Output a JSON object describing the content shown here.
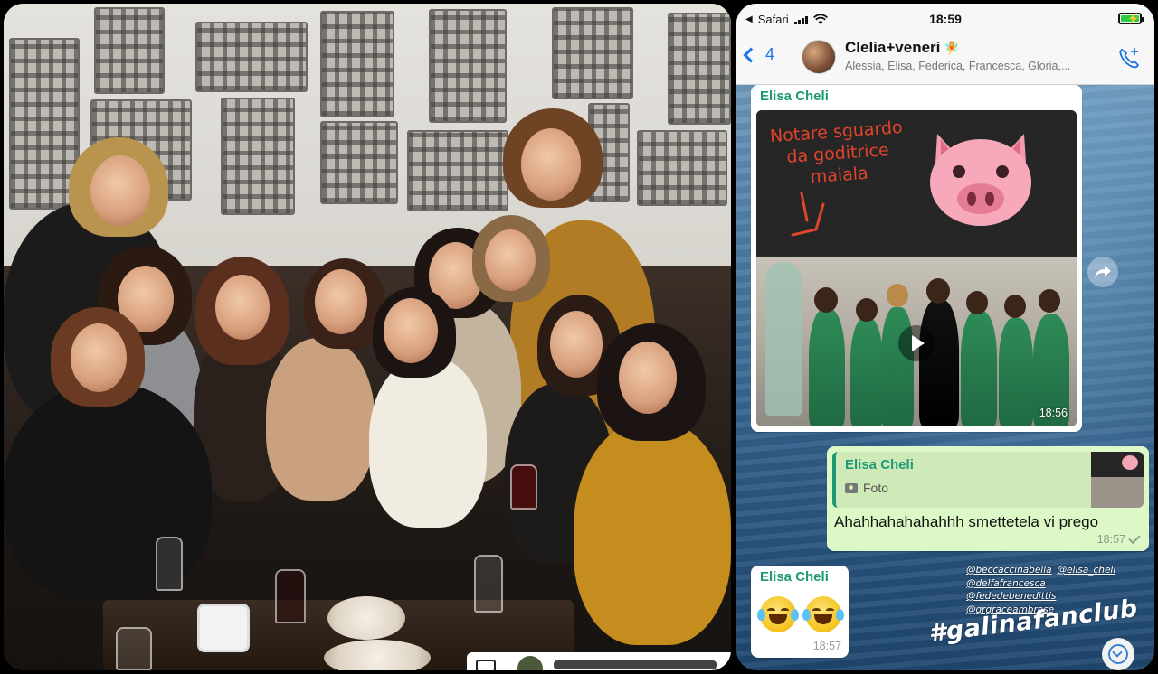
{
  "status_bar": {
    "carrier": "Safari",
    "time": "18:59"
  },
  "chat_header": {
    "back_count": "4",
    "group_name": "Clelia+veneri",
    "group_emoji": "🧚",
    "members": "Alessia, Elisa, Federica, Francesca, Gloria,..."
  },
  "messages": {
    "media": {
      "sender": "Elisa Cheli",
      "note_text": "Notare sguardo da goditrice maiala",
      "time": "18:56"
    },
    "reply": {
      "quoted_sender": "Elisa Cheli",
      "quoted_type": "Foto",
      "text": "Ahahhahahahahhh smettetela vi prego",
      "time": "18:57"
    },
    "emoji": {
      "sender": "Elisa Cheli",
      "time": "18:57"
    }
  },
  "overlay": {
    "mention_1": "@beccaccinabella",
    "mention_2": "@elisa_cheli",
    "mention_3": "@delfafrancesca",
    "mention_4": "@fededebenedittis",
    "mention_5": "@grgraceambrose",
    "hashtag": "#galinafanclub"
  },
  "colors": {
    "sender": "#1d9a74",
    "outgoing_bubble": "#dcf8c6",
    "link_blue": "#1a73e8",
    "note_red": "#e0442b"
  }
}
